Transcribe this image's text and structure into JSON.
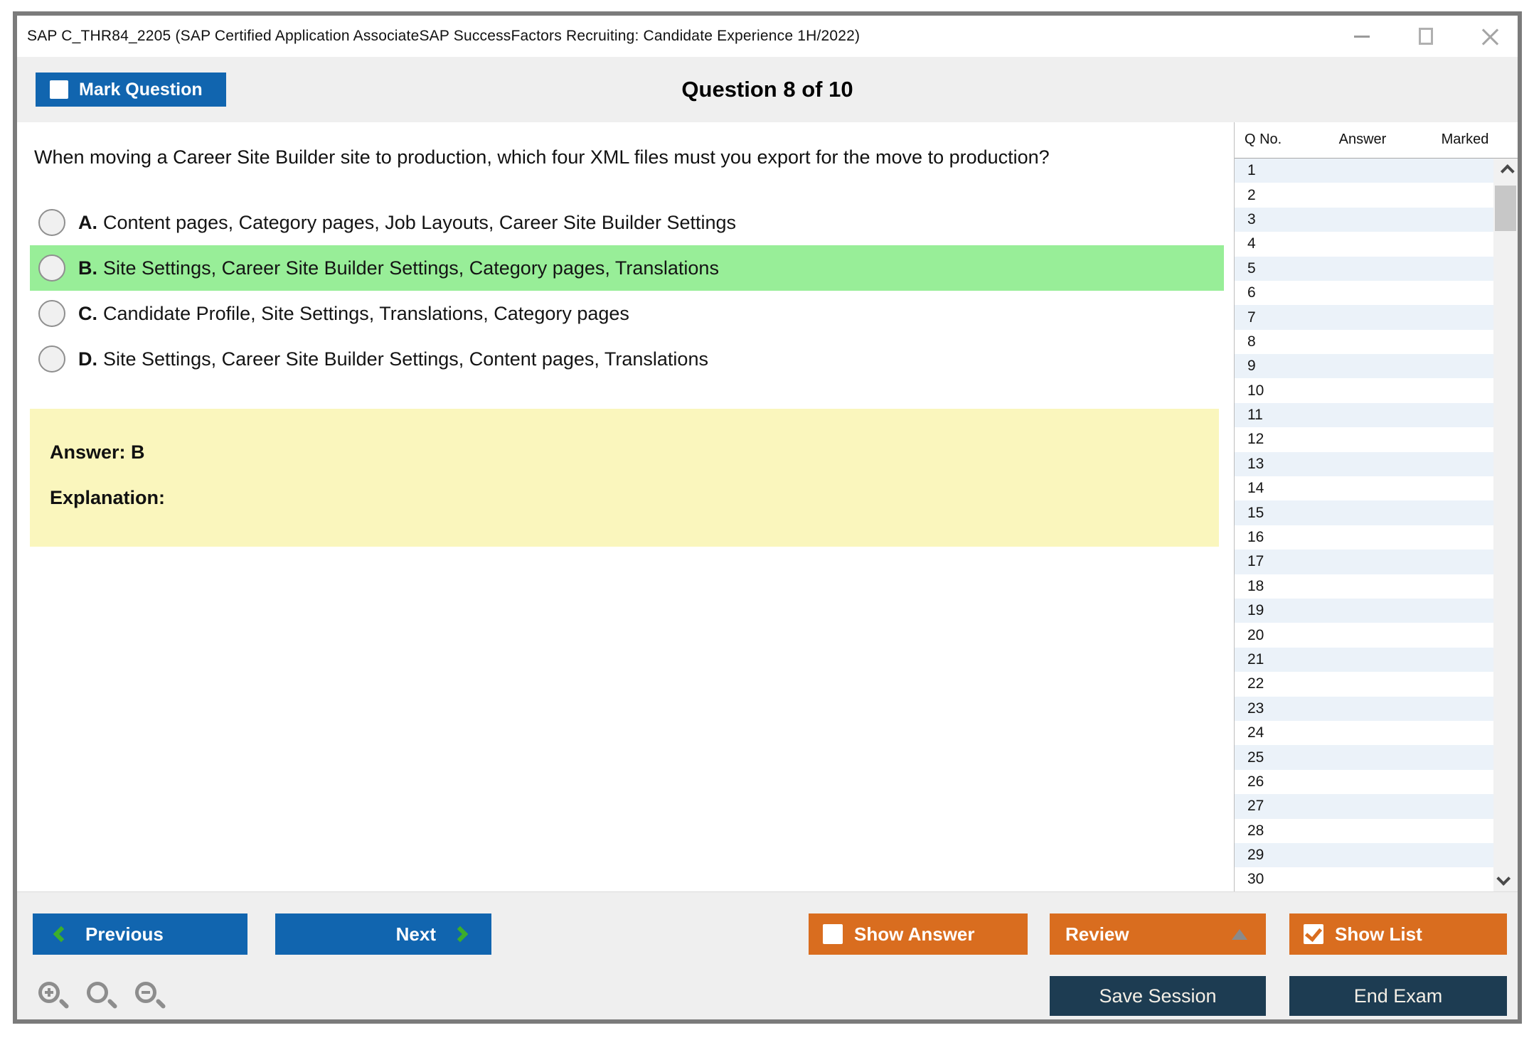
{
  "window": {
    "title": "SAP C_THR84_2205 (SAP Certified Application AssociateSAP SuccessFactors Recruiting: Candidate Experience 1H/2022)"
  },
  "header": {
    "mark_question_label": "Mark Question",
    "question_counter": "Question 8 of 10"
  },
  "question": {
    "text": "When moving a Career Site Builder site to production, which four XML files must you export for the move to production?",
    "options": [
      {
        "letter": "A.",
        "text": "Content pages, Category pages, Job Layouts, Career Site Builder Settings",
        "highlighted": false
      },
      {
        "letter": "B.",
        "text": "Site Settings, Career Site Builder Settings, Category pages, Translations",
        "highlighted": true
      },
      {
        "letter": "C.",
        "text": "Candidate Profile, Site Settings, Translations, Category pages",
        "highlighted": false
      },
      {
        "letter": "D.",
        "text": "Site Settings, Career Site Builder Settings, Content pages, Translations",
        "highlighted": false
      }
    ],
    "answer_label": "Answer: B",
    "explanation_label": "Explanation:"
  },
  "sidebar": {
    "columns": {
      "qno": "Q No.",
      "answer": "Answer",
      "marked": "Marked"
    },
    "rows": [
      "1",
      "2",
      "3",
      "4",
      "5",
      "6",
      "7",
      "8",
      "9",
      "10",
      "11",
      "12",
      "13",
      "14",
      "15",
      "16",
      "17",
      "18",
      "19",
      "20",
      "21",
      "22",
      "23",
      "24",
      "25",
      "26",
      "27",
      "28",
      "29",
      "30"
    ]
  },
  "footer": {
    "previous_label": "Previous",
    "next_label": "Next",
    "show_answer_label": "Show Answer",
    "review_label": "Review",
    "show_list_label": "Show List",
    "save_session_label": "Save Session",
    "end_exam_label": "End Exam"
  },
  "colors": {
    "accent_blue": "#1165af",
    "accent_orange": "#d96d1f",
    "accent_navy": "#1d3c52",
    "highlight_green": "#98ee98",
    "answer_yellow": "#faf6bd",
    "chevron_green": "#3cae2b",
    "band_gray": "#efefef",
    "alt_row_blue": "#ebf2f9"
  }
}
